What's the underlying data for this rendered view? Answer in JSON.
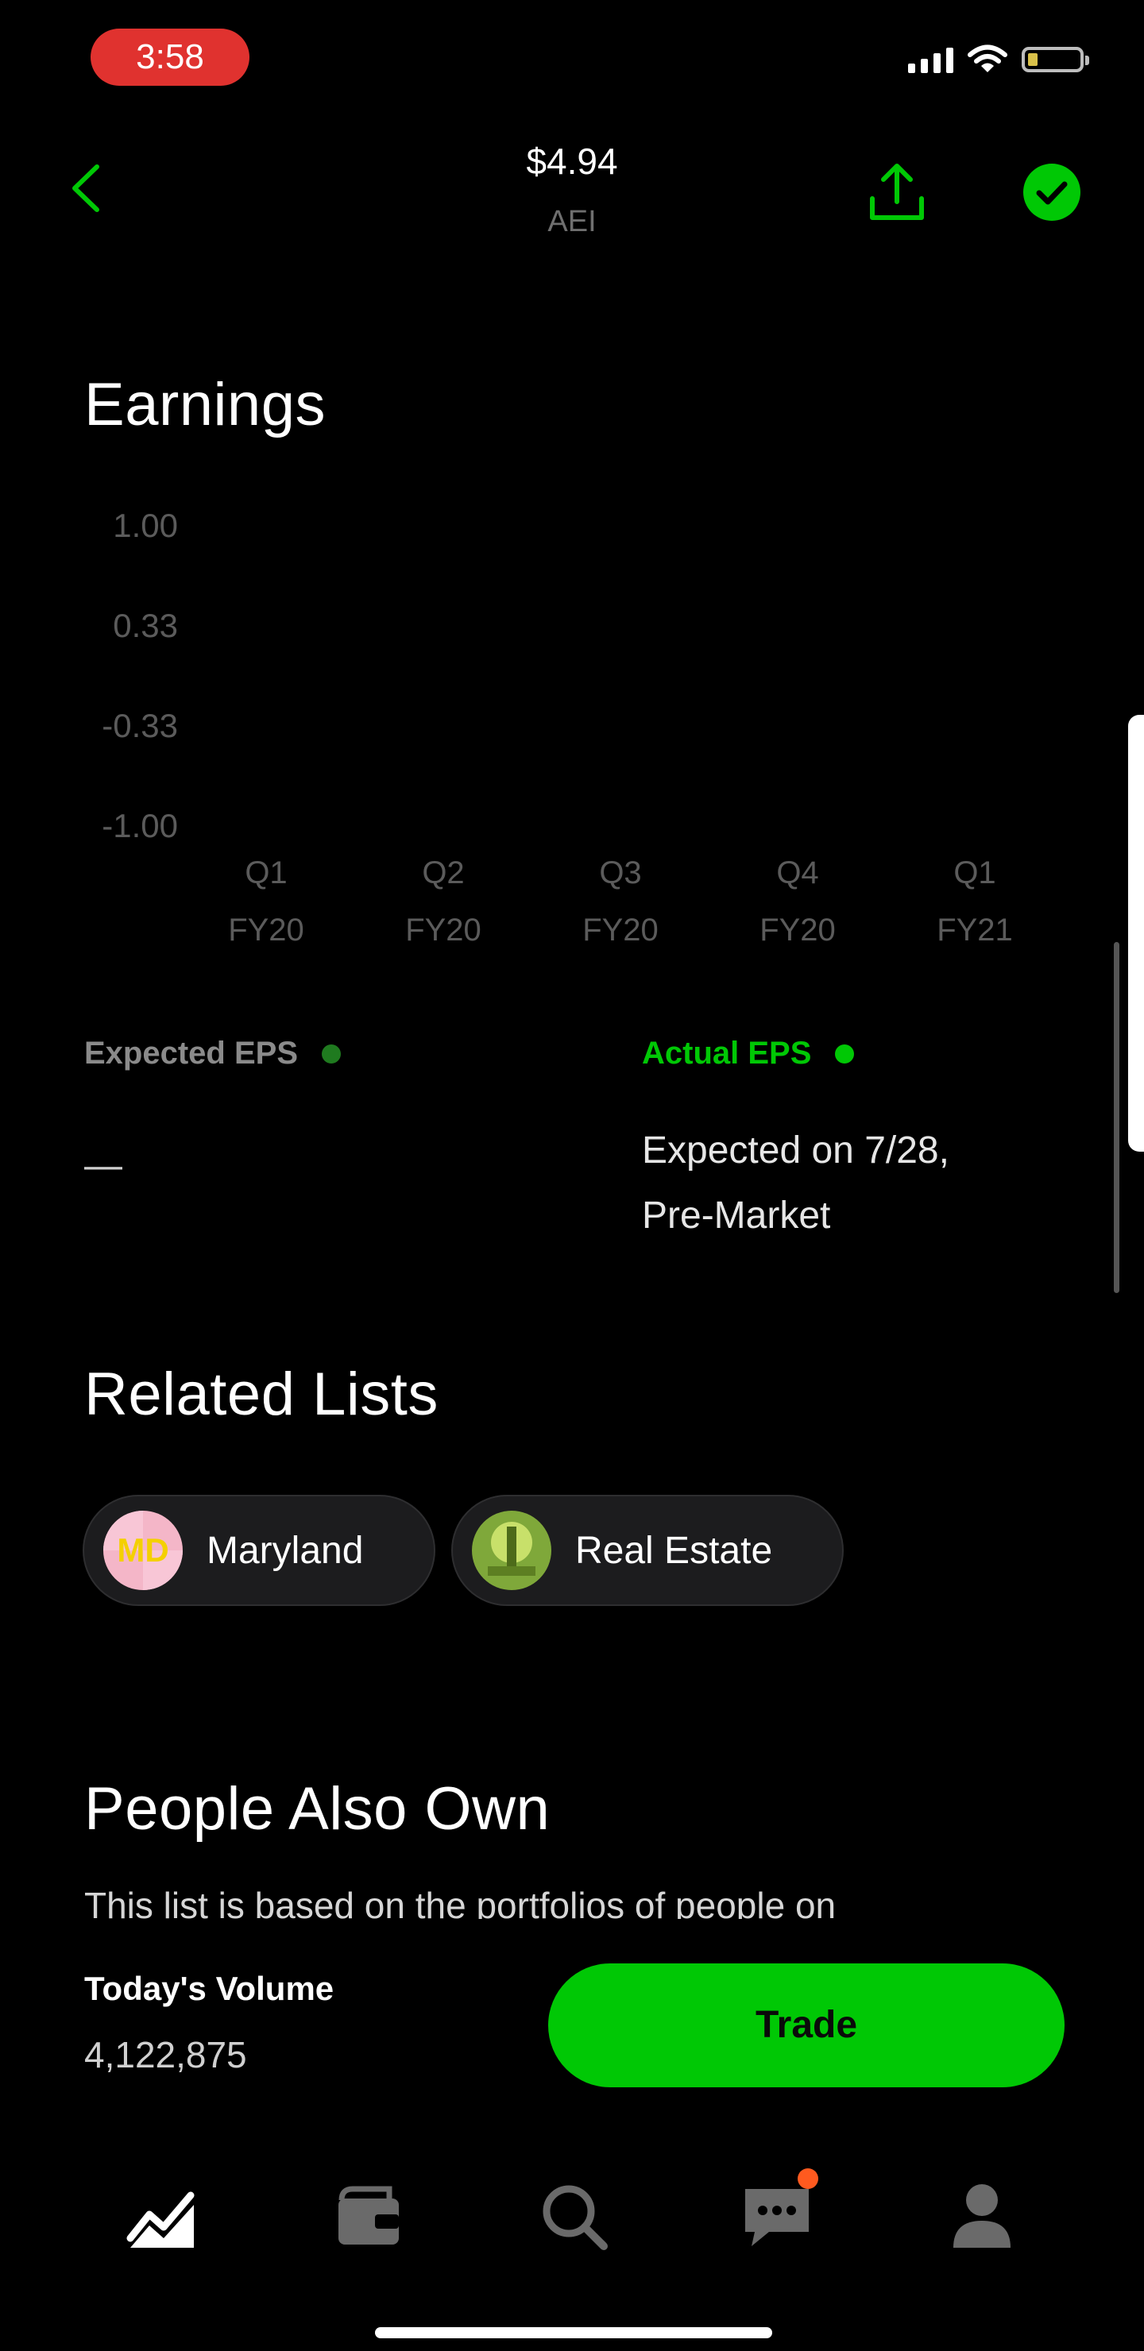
{
  "status_bar": {
    "time": "3:58"
  },
  "header": {
    "price": "$4.94",
    "ticker": "AEI"
  },
  "earnings": {
    "title": "Earnings",
    "expected_label": "Expected EPS",
    "expected_value": "—",
    "actual_label": "Actual EPS",
    "actual_value_line1": "Expected on 7/28,",
    "actual_value_line2": "Pre-Market",
    "colors": {
      "expected": "#1f7a1f",
      "actual": "#00c805"
    }
  },
  "chart_data": {
    "type": "scatter",
    "title": "",
    "y_ticks": [
      "1.00",
      "0.33",
      "-0.33",
      "-1.00"
    ],
    "ylim": [
      -1.0,
      1.0
    ],
    "categories": [
      {
        "q": "Q1",
        "fy": "FY20"
      },
      {
        "q": "Q2",
        "fy": "FY20"
      },
      {
        "q": "Q3",
        "fy": "FY20"
      },
      {
        "q": "Q4",
        "fy": "FY20"
      },
      {
        "q": "Q1",
        "fy": "FY21"
      }
    ],
    "series": [
      {
        "values": [
          null,
          null,
          null,
          null,
          null
        ]
      },
      {
        "values": [
          null,
          null,
          null,
          null,
          null
        ]
      }
    ],
    "grid": false
  },
  "related_lists": {
    "title": "Related Lists",
    "items": [
      {
        "label": "Maryland",
        "icon": "maryland-flag-icon"
      },
      {
        "label": "Real Estate",
        "icon": "real-estate-icon"
      }
    ]
  },
  "people_also_own": {
    "title": "People Also Own",
    "description": "This list is based on the portfolios of people on"
  },
  "bottom": {
    "volume_label": "Today's Volume",
    "volume_value": "4,122,875",
    "trade_label": "Trade"
  },
  "tabs": [
    {
      "icon": "chart-icon"
    },
    {
      "icon": "wallet-icon"
    },
    {
      "icon": "search-icon"
    },
    {
      "icon": "messages-icon"
    },
    {
      "icon": "account-icon"
    }
  ],
  "colors": {
    "accent": "#00c805",
    "background": "#000000"
  }
}
